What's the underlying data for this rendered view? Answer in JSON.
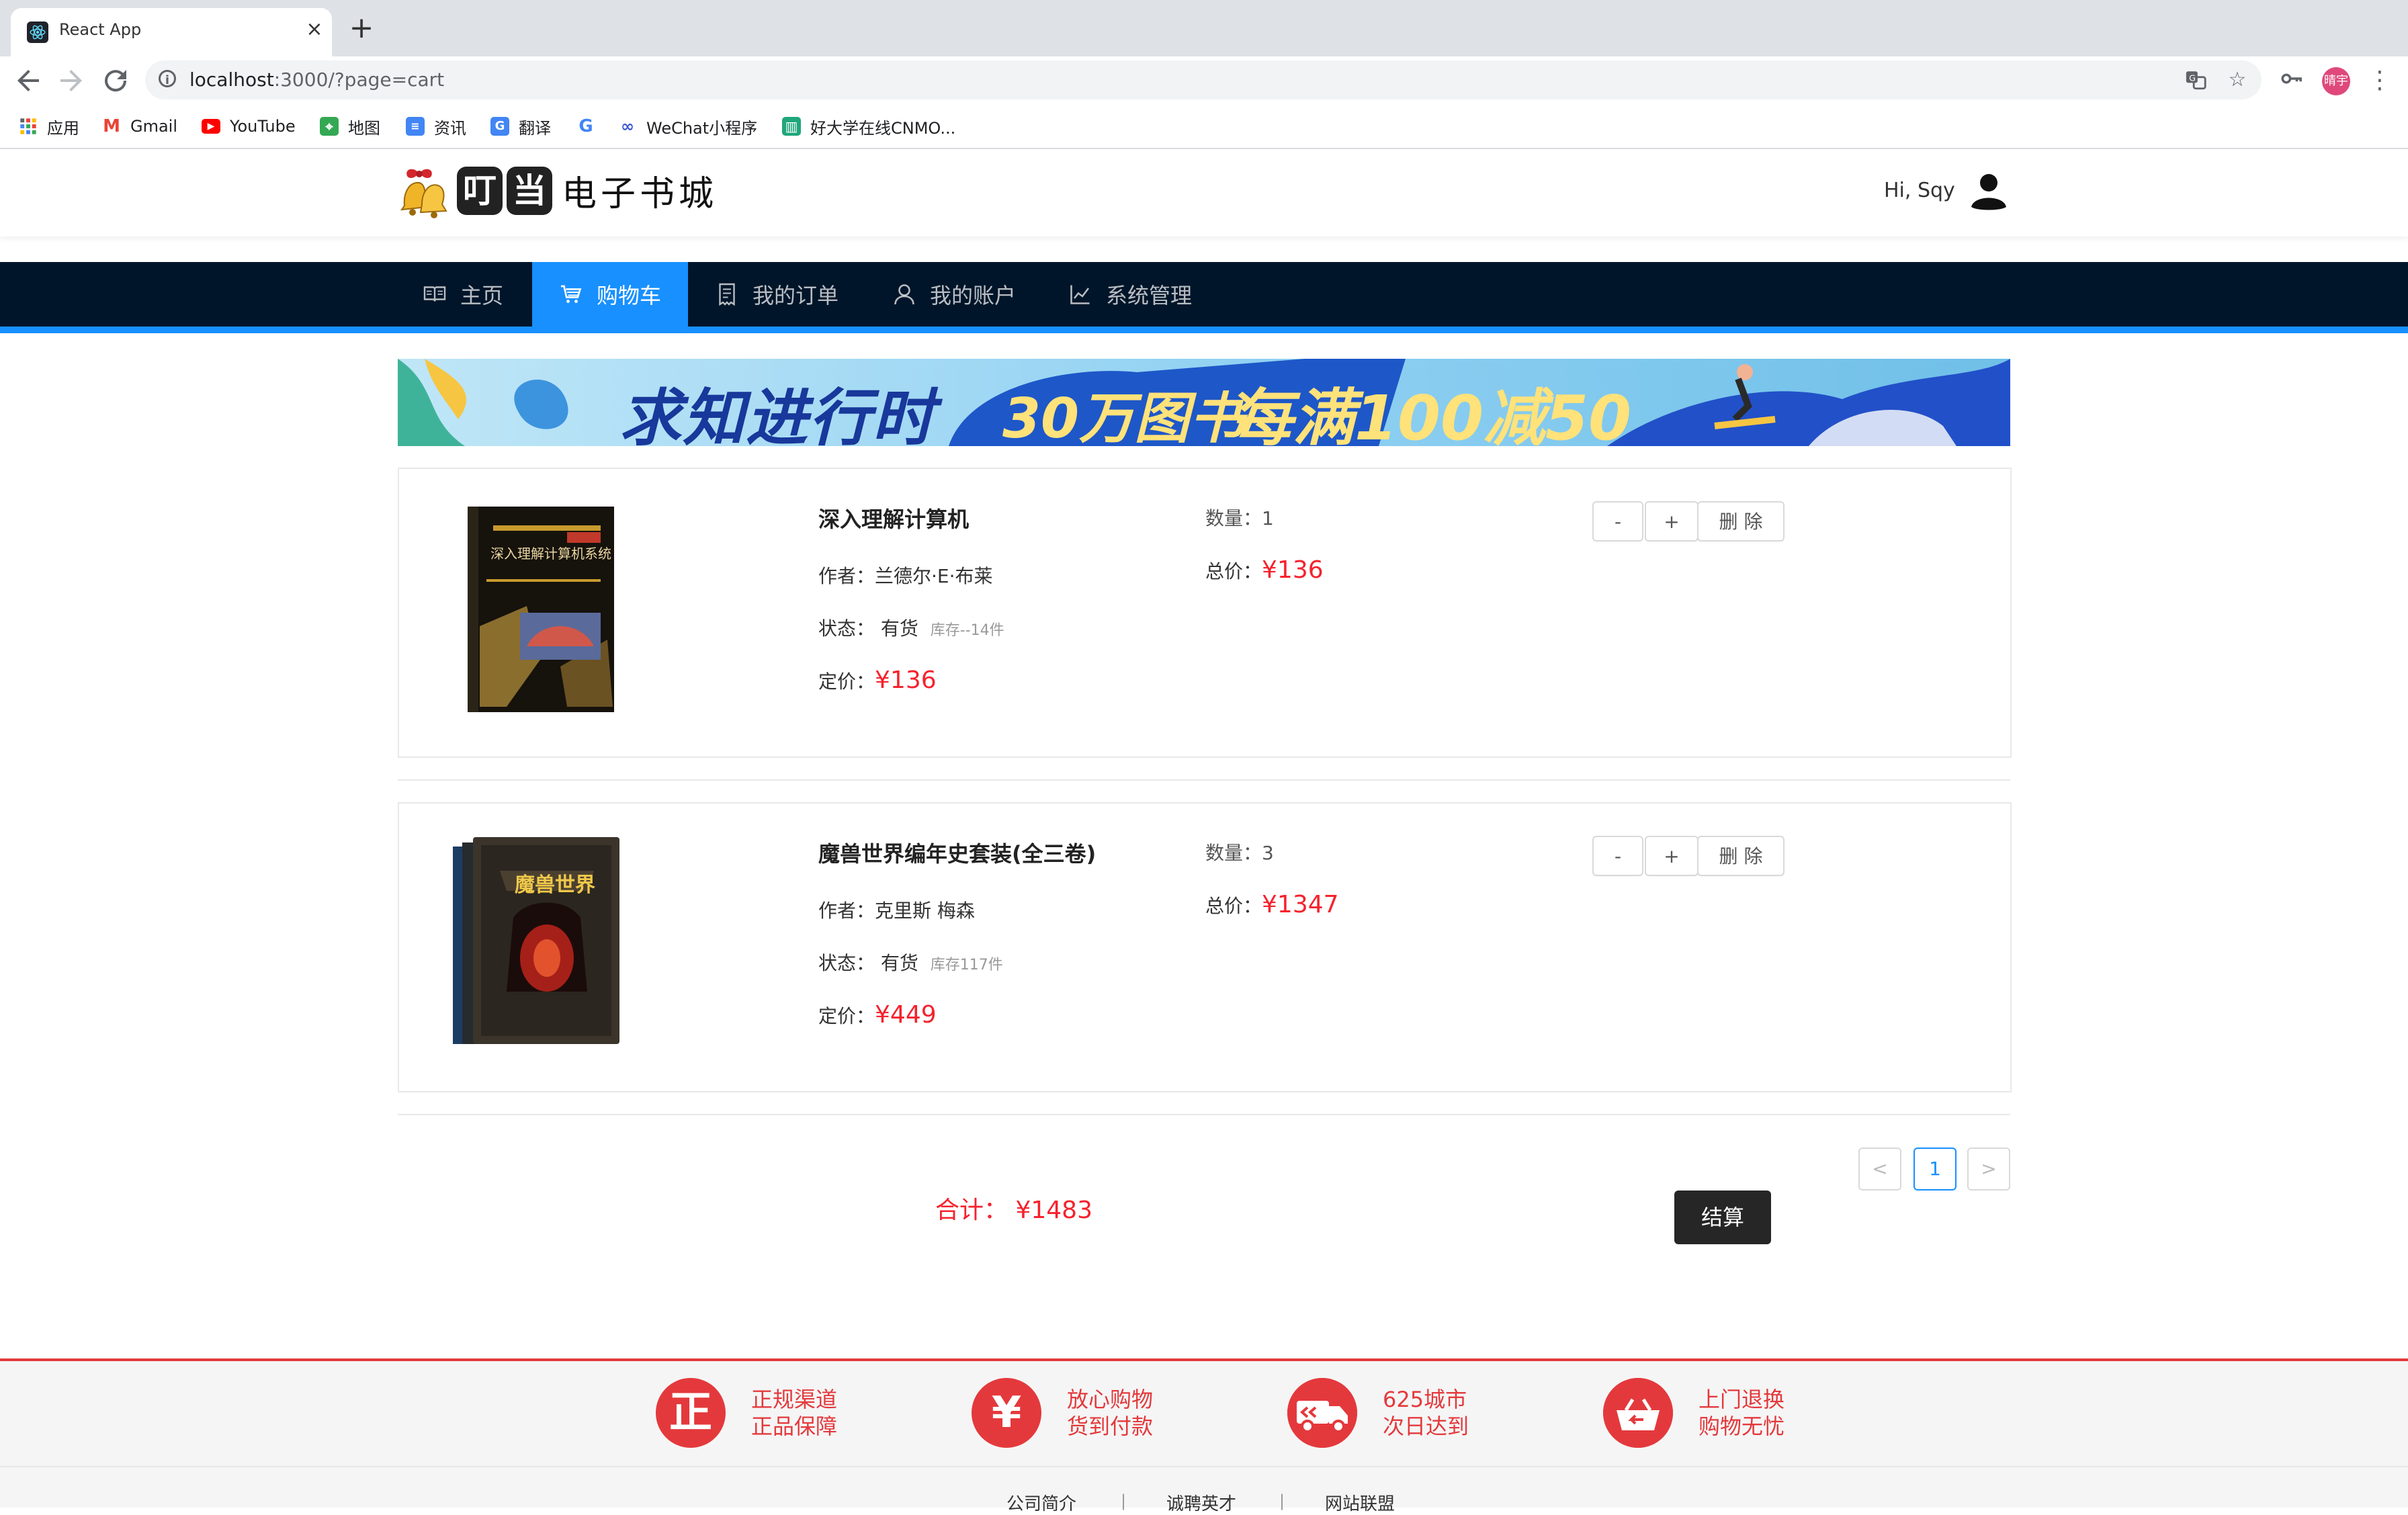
{
  "browser": {
    "tab_title": "React App",
    "tab_close": "×",
    "new_tab": "+",
    "url_host": "localhost",
    "url_path": ":3000/?page=cart",
    "profile_initials": "晴宇",
    "bookmarks": [
      {
        "label": "应用",
        "icon": "apps-grid-icon",
        "color": "#4285f4"
      },
      {
        "label": "Gmail",
        "icon": "gmail-icon",
        "color": "#ea4335"
      },
      {
        "label": "YouTube",
        "icon": "youtube-icon",
        "color": "#ff0000"
      },
      {
        "label": "地图",
        "icon": "maps-icon",
        "color": "#34a853"
      },
      {
        "label": "资讯",
        "icon": "news-icon",
        "color": "#4285f4"
      },
      {
        "label": "翻译",
        "icon": "translate-icon",
        "color": "#4285f4"
      },
      {
        "label": "",
        "icon": "google-icon",
        "color": "#4285f4"
      },
      {
        "label": "WeChat小程序",
        "icon": "link-icon",
        "color": "#3c5ad1"
      },
      {
        "label": "好大学在线CNMO...",
        "icon": "book-icon",
        "color": "#1fa67a"
      }
    ]
  },
  "header": {
    "logo_box_1": "叮",
    "logo_box_2": "当",
    "logo_rest": "电子书城",
    "greeting": "Hi, Sqy"
  },
  "nav": {
    "items": [
      {
        "label": "主页",
        "icon": "book-icon"
      },
      {
        "label": "购物车",
        "icon": "shopping-cart-icon",
        "active": true
      },
      {
        "label": "我的订单",
        "icon": "order-list-icon"
      },
      {
        "label": "我的账户",
        "icon": "user-icon"
      },
      {
        "label": "系统管理",
        "icon": "line-chart-icon"
      }
    ]
  },
  "banner": {
    "text_left": "求知进行时",
    "text_mid": "30万图书",
    "text_right": "每满100减50"
  },
  "cart": {
    "labels": {
      "author": "作者：",
      "status": "状态：",
      "price": "定价：",
      "quantity": "数量：",
      "total": "总价："
    },
    "minus": "-",
    "plus": "+",
    "delete": "删 除",
    "items": [
      {
        "title": "深入理解计算机",
        "author": "兰德尔·E·布莱",
        "status": "有货",
        "stock": "库存--14件",
        "price": "¥136",
        "quantity": "1",
        "total": "¥136",
        "cover_title": "深入理解计算机系统"
      },
      {
        "title": "魔兽世界编年史套装(全三卷)",
        "author": "克里斯  梅森",
        "status": "有货",
        "stock": "库存117件",
        "price": "¥449",
        "quantity": "3",
        "total": "¥1347",
        "cover_title": "魔兽世界"
      }
    ]
  },
  "pagination": {
    "prev": "<",
    "page": "1",
    "next": ">"
  },
  "summary": {
    "total_label": "合计：",
    "total_value": "¥1483",
    "checkout": "结算"
  },
  "footer": {
    "promises": [
      {
        "icon_char": "正",
        "line1": "正规渠道",
        "line2": "正品保障"
      },
      {
        "icon_char": "¥",
        "line1": "放心购物",
        "line2": "货到付款"
      },
      {
        "icon_char": "车",
        "line1": "625城市",
        "line2": "次日达到"
      },
      {
        "icon_char": "篮",
        "line1": "上门退换",
        "line2": "购物无忧"
      }
    ],
    "links": [
      "公司简介",
      "诚聘英才",
      "网站联盟"
    ],
    "separator": "|"
  },
  "colors": {
    "accent": "#1890ff",
    "nav_bg": "#001529",
    "price_red": "#f5222d",
    "footer_red": "#e4393c",
    "checkout_bg": "#262626"
  }
}
